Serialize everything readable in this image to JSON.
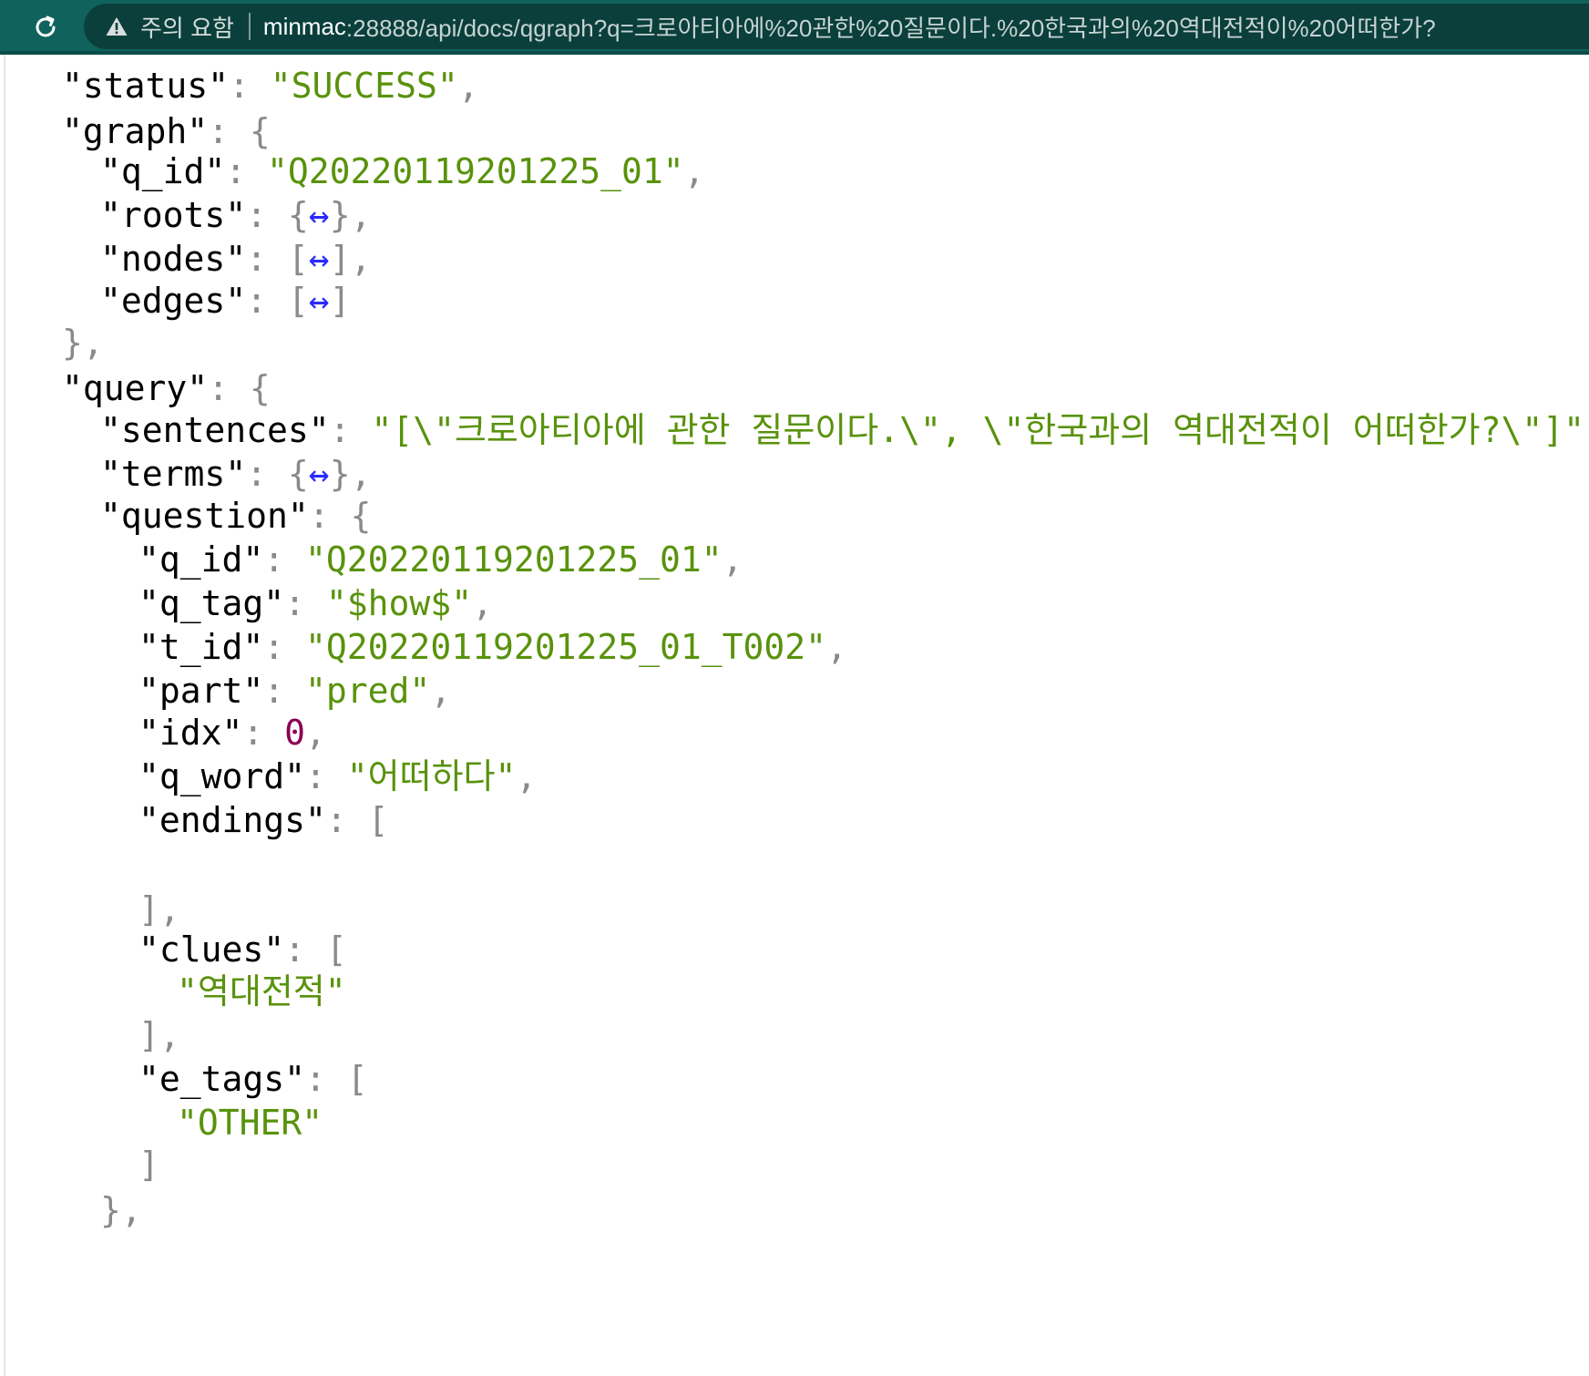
{
  "browser": {
    "security_label": "주의 요함",
    "url_host": "minmac",
    "url_path": ":28888/api/docs/qgraph?q=크로아티아에%20관한%20질문이다.%20한국과의%20역대전적이%20어떠한가?"
  },
  "json": {
    "status_key": "\"status\"",
    "status_value": "\"SUCCESS\"",
    "graph_key": "\"graph\"",
    "graph_q_id_key": "\"q_id\"",
    "graph_q_id_value": "\"Q20220119201225_01\"",
    "roots_key": "\"roots\"",
    "nodes_key": "\"nodes\"",
    "edges_key": "\"edges\"",
    "query_key": "\"query\"",
    "sentences_key": "\"sentences\"",
    "sentences_value": "\"[\\\"크로아티아에 관한 질문이다.\\\", \\\"한국과의 역대전적이 어떠한가?\\\"]\"",
    "terms_key": "\"terms\"",
    "question_key": "\"question\"",
    "q_id_key": "\"q_id\"",
    "q_id_value": "\"Q20220119201225_01\"",
    "q_tag_key": "\"q_tag\"",
    "q_tag_value": "\"$how$\"",
    "t_id_key": "\"t_id\"",
    "t_id_value": "\"Q20220119201225_01_T002\"",
    "part_key": "\"part\"",
    "part_value": "\"pred\"",
    "idx_key": "\"idx\"",
    "idx_value": "0",
    "q_word_key": "\"q_word\"",
    "q_word_value": "\"어떠하다\"",
    "endings_key": "\"endings\"",
    "clues_key": "\"clues\"",
    "clues_item": "\"역대전적\"",
    "e_tags_key": "\"e_tags\"",
    "e_tags_item": "\"OTHER\"",
    "collapsed_symbol": "↔"
  }
}
